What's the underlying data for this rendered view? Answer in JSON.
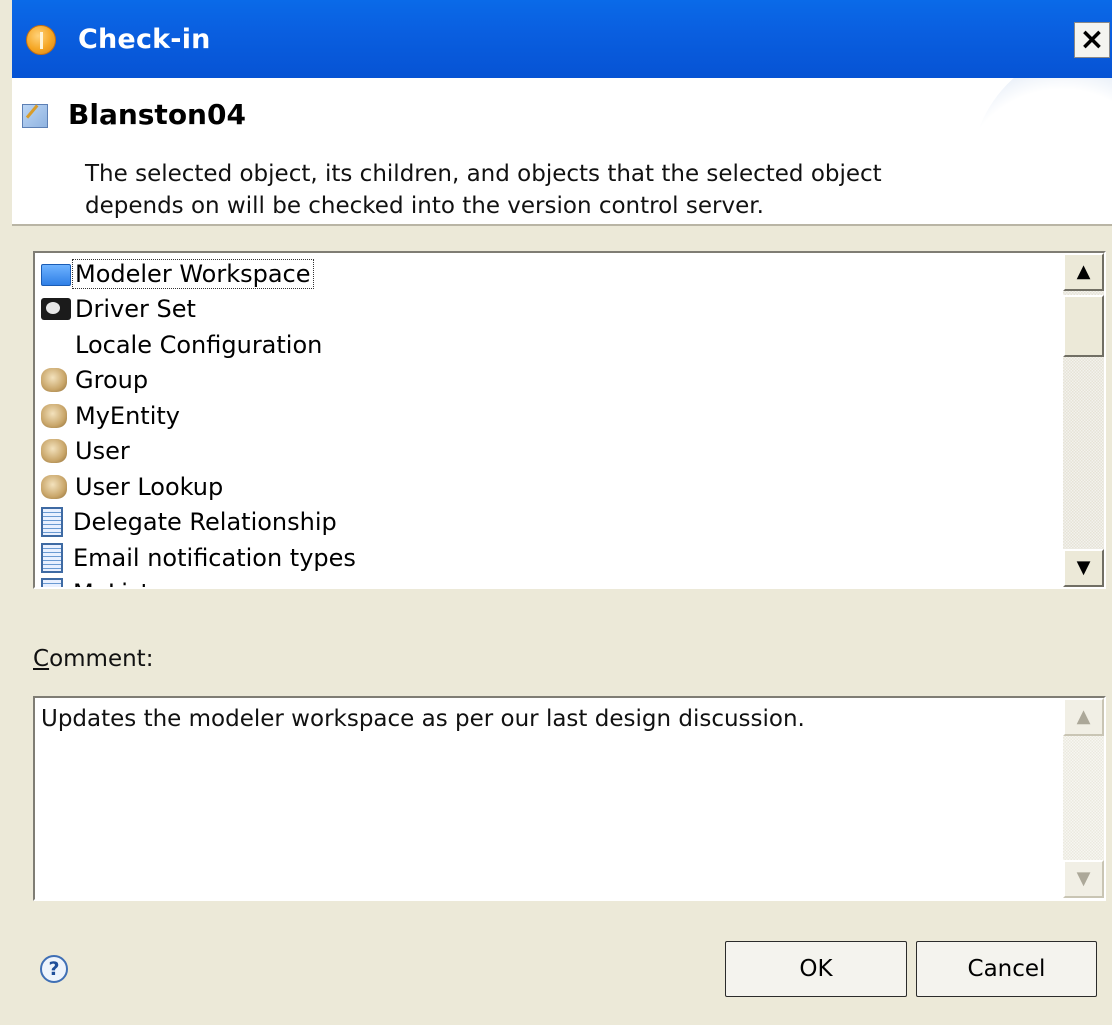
{
  "window": {
    "title": "Check-in",
    "close_label": "×"
  },
  "header": {
    "object_name": "Blanston04",
    "description": "The selected object, its children, and objects that the selected object depends on will be checked into the version control server."
  },
  "object_list": {
    "items": [
      {
        "label": "Modeler Workspace",
        "icon": "workspace-icon",
        "selected": true
      },
      {
        "label": "Driver Set",
        "icon": "driver-set-icon"
      },
      {
        "label": "Locale Configuration",
        "icon": "none"
      },
      {
        "label": "Group",
        "icon": "entity-icon"
      },
      {
        "label": "MyEntity",
        "icon": "entity-icon"
      },
      {
        "label": "User",
        "icon": "entity-icon"
      },
      {
        "label": "User Lookup",
        "icon": "entity-icon"
      },
      {
        "label": "Delegate Relationship",
        "icon": "list-icon"
      },
      {
        "label": "Email notification types",
        "icon": "list-icon"
      },
      {
        "label": "MyList",
        "icon": "list-icon"
      }
    ],
    "scroll_up": "▲",
    "scroll_down": "▼"
  },
  "comment": {
    "label_prefix": "",
    "label_mnemonic": "C",
    "label_rest": "omment:",
    "value": "Updates the modeler workspace as per our last design discussion.",
    "scroll_up": "▲",
    "scroll_down": "▼"
  },
  "footer": {
    "help_label": "?",
    "ok_label": "OK",
    "cancel_label": "Cancel"
  },
  "colors": {
    "titlebar": "#0a5fe0",
    "dialog_bg": "#ece9d8"
  }
}
